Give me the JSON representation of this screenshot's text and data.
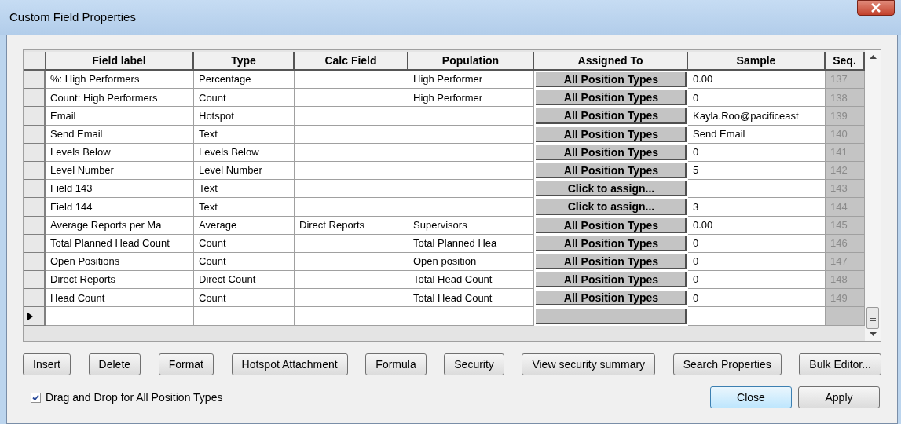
{
  "window": {
    "title": "Custom Field Properties"
  },
  "table": {
    "columns": [
      "Field label",
      "Type",
      "Calc Field",
      "Population",
      "Assigned To",
      "Sample",
      "Seq."
    ],
    "rows": [
      {
        "current": false,
        "cells": [
          "%: High Performers",
          "Percentage",
          "",
          "High Performer",
          "All Position Types",
          "0.00",
          "137"
        ]
      },
      {
        "current": false,
        "cells": [
          "Count: High Performers",
          "Count",
          "",
          "High Performer",
          "All Position Types",
          "0",
          "138"
        ]
      },
      {
        "current": false,
        "cells": [
          "Email",
          "Hotspot",
          "",
          "",
          "All Position Types",
          "Kayla.Roo@pacificeast",
          "139"
        ]
      },
      {
        "current": false,
        "cells": [
          "Send Email",
          "Text",
          "",
          "",
          "All Position Types",
          "Send Email",
          "140"
        ]
      },
      {
        "current": false,
        "cells": [
          "Levels Below",
          "Levels Below",
          "",
          "",
          "All Position Types",
          "0",
          "141"
        ]
      },
      {
        "current": false,
        "cells": [
          "Level Number",
          "Level Number",
          "",
          "",
          "All Position Types",
          "5",
          "142"
        ]
      },
      {
        "current": false,
        "cells": [
          "Field 143",
          "Text",
          "",
          "",
          "Click to assign...",
          "",
          "143"
        ]
      },
      {
        "current": false,
        "cells": [
          "Field 144",
          "Text",
          "",
          "",
          "Click to assign...",
          "3",
          "144"
        ]
      },
      {
        "current": false,
        "cells": [
          "Average Reports per Ma",
          "Average",
          "Direct Reports",
          "Supervisors",
          "All Position Types",
          "0.00",
          "145"
        ]
      },
      {
        "current": false,
        "cells": [
          "Total Planned Head Count",
          "Count",
          "",
          "Total Planned Hea",
          "All Position Types",
          "0",
          "146"
        ]
      },
      {
        "current": false,
        "cells": [
          "Open Positions",
          "Count",
          "",
          "Open position",
          "All Position Types",
          "0",
          "147"
        ]
      },
      {
        "current": false,
        "cells": [
          "Direct Reports",
          "Direct Count",
          "",
          "Total Head Count",
          "All Position Types",
          "0",
          "148"
        ]
      },
      {
        "current": false,
        "cells": [
          "Head Count",
          "Count",
          "",
          "Total Head Count",
          "All Position Types",
          "0",
          "149"
        ]
      },
      {
        "current": true,
        "cells": [
          "",
          "",
          "",
          "",
          "",
          "",
          ""
        ]
      }
    ]
  },
  "buttons": [
    "Insert",
    "Delete",
    "Format",
    "Hotspot Attachment",
    "Formula",
    "Security",
    "View security summary",
    "Search Properties",
    "Bulk Editor..."
  ],
  "checkbox": {
    "label": "Drag and Drop for All Position Types",
    "checked": true
  },
  "dialog_buttons": [
    {
      "label": "Close",
      "default": true
    },
    {
      "label": "Apply",
      "default": false
    }
  ]
}
